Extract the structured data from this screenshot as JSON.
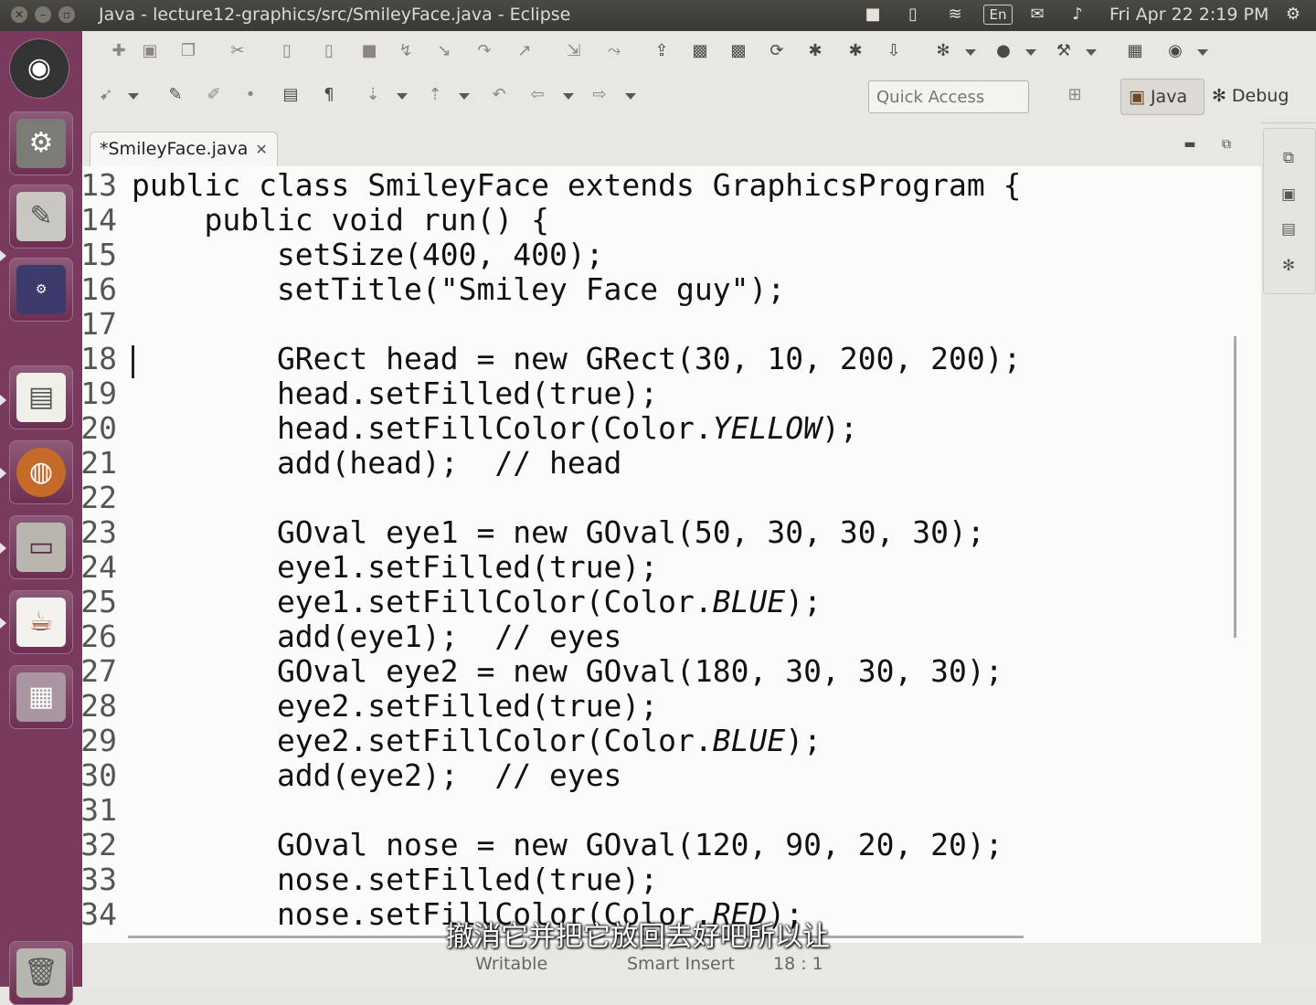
{
  "window": {
    "title": "Java - lecture12-graphics/src/SmileyFace.java - Eclipse"
  },
  "system_tray": {
    "keyboard": "En",
    "datetime": "Fri Apr 22  2:19 PM"
  },
  "toolbar": {
    "quick_access_placeholder": "Quick Access",
    "perspective_java": "Java",
    "perspective_debug": "Debug"
  },
  "editor": {
    "tab_label": "*SmileyFace.java",
    "lines": [
      {
        "num": "13",
        "text": "public class SmileyFace extends GraphicsProgram {"
      },
      {
        "num": "14",
        "text": "    public void run() {"
      },
      {
        "num": "15",
        "text": "        setSize(400, 400);"
      },
      {
        "num": "16",
        "text": "        setTitle(\"Smiley Face guy\");"
      },
      {
        "num": "17",
        "text": ""
      },
      {
        "num": "18",
        "text": "        GRect head = new GRect(30, 10, 200, 200);"
      },
      {
        "num": "19",
        "text": "        head.setFilled(true);"
      },
      {
        "num": "20",
        "text": "        head.setFillColor(Color.",
        "italic": "YELLOW",
        "tail": ");"
      },
      {
        "num": "21",
        "text": "        add(head);  // head"
      },
      {
        "num": "22",
        "text": ""
      },
      {
        "num": "23",
        "text": "        GOval eye1 = new GOval(50, 30, 30, 30);"
      },
      {
        "num": "24",
        "text": "        eye1.setFilled(true);"
      },
      {
        "num": "25",
        "text": "        eye1.setFillColor(Color.",
        "italic": "BLUE",
        "tail": ");"
      },
      {
        "num": "26",
        "text": "        add(eye1);  // eyes"
      },
      {
        "num": "27",
        "text": "        GOval eye2 = new GOval(180, 30, 30, 30);"
      },
      {
        "num": "28",
        "text": "        eye2.setFilled(true);"
      },
      {
        "num": "29",
        "text": "        eye2.setFillColor(Color.",
        "italic": "BLUE",
        "tail": ");"
      },
      {
        "num": "30",
        "text": "        add(eye2);  // eyes"
      },
      {
        "num": "31",
        "text": ""
      },
      {
        "num": "32",
        "text": "        GOval nose = new GOval(120, 90, 20, 20);"
      },
      {
        "num": "33",
        "text": "        nose.setFilled(true);"
      },
      {
        "num": "34",
        "text": "        nose.setFillColor(Color.",
        "italic": "RED",
        "tail": ");"
      }
    ]
  },
  "statusbar": {
    "writable": "Writable",
    "insert_mode": "Smart Insert",
    "position": "18 : 1"
  },
  "subtitle": "撤消它并把它放回去好吧所以让",
  "colors": {
    "launcher": "#7a3a5e",
    "topbar": "#3c3b37",
    "editor_bg": "#fbfbfa"
  }
}
